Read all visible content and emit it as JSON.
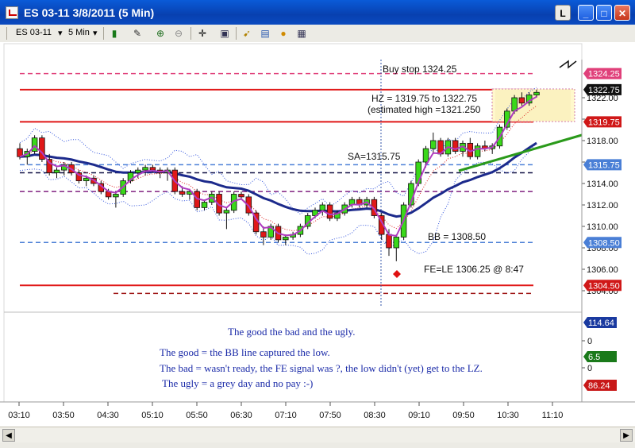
{
  "window": {
    "title": "ES 03-11  3/8/2011 (5 Min)",
    "buttons": [
      "L",
      "_",
      "□",
      "✕"
    ]
  },
  "toolbar": {
    "instrument": "ES 03-11",
    "interval": "5 Min"
  },
  "annotations": {
    "buy_stop": "Buy stop 1324.25",
    "hz": "HZ = 1319.75 to 1322.75",
    "est_high": "(estimated high =1321.250",
    "sa": "SA=1315.75",
    "bb": "BB = 1308.50",
    "fe": "FE=LE 1306.25 @ 8:47",
    "note_title": "The good the bad and the ugly.",
    "note_good": "The good = the BB line captured the low.",
    "note_bad": "The bad = wasn't ready, the FE signal was ?, the low didn't (yet) get to the LZ.",
    "note_ugly": "The ugly = a grey day and no pay :-)"
  },
  "chart_data": {
    "type": "candlestick",
    "interval": "5 Min",
    "x_labels": [
      "03:10",
      "03:50",
      "04:30",
      "05:10",
      "05:50",
      "06:30",
      "07:10",
      "07:50",
      "08:30",
      "09:10",
      "09:50",
      "10:30",
      "11:10"
    ],
    "y_ticks": [
      1304.0,
      1306.0,
      1308.0,
      1310.0,
      1312.0,
      1314.0,
      1316.0,
      1318.0,
      1320.0,
      1322.0
    ],
    "ylim": [
      1303.25,
      1325.25
    ],
    "price_tags": [
      {
        "label": "1324.25",
        "value": 1324.25,
        "color": "#e0407a"
      },
      {
        "label": "1322.75",
        "value": 1322.75,
        "color": "#111111"
      },
      {
        "label": "1319.75",
        "value": 1319.75,
        "color": "#d01818"
      },
      {
        "label": "1315.75",
        "value": 1315.75,
        "color": "#4a7fd6"
      },
      {
        "label": "1308.50",
        "value": 1308.5,
        "color": "#4a7fd6"
      },
      {
        "label": "1304.50",
        "value": 1304.5,
        "color": "#d01818"
      }
    ],
    "levels": [
      {
        "value": 1324.25,
        "color": "#e0407a",
        "style": "dashed"
      },
      {
        "value": 1322.75,
        "color": "#e01818",
        "style": "solid"
      },
      {
        "value": 1319.75,
        "color": "#e01818",
        "style": "solid"
      },
      {
        "value": 1315.75,
        "color": "#4a7fd6",
        "style": "dashed"
      },
      {
        "value": 1315.0,
        "color": "#111144",
        "style": "dashed"
      },
      {
        "value": 1313.25,
        "color": "#802080",
        "style": "dashed"
      },
      {
        "value": 1308.5,
        "color": "#4a7fd6",
        "style": "dashed"
      },
      {
        "value": 1304.5,
        "color": "#e01818",
        "style": "solid"
      },
      {
        "value": 1303.75,
        "color": "#a01818",
        "style": "dashed"
      }
    ],
    "candles": [
      {
        "o": 1317.25,
        "h": 1317.75,
        "l": 1316.25,
        "c": 1316.5
      },
      {
        "o": 1316.5,
        "h": 1317.25,
        "l": 1315.75,
        "c": 1317.0
      },
      {
        "o": 1317.0,
        "h": 1318.5,
        "l": 1316.75,
        "c": 1318.25
      },
      {
        "o": 1318.25,
        "h": 1318.5,
        "l": 1316.0,
        "c": 1316.25
      },
      {
        "o": 1316.25,
        "h": 1316.75,
        "l": 1314.75,
        "c": 1315.0
      },
      {
        "o": 1315.0,
        "h": 1315.5,
        "l": 1314.5,
        "c": 1315.25
      },
      {
        "o": 1315.25,
        "h": 1316.0,
        "l": 1314.75,
        "c": 1315.75
      },
      {
        "o": 1315.75,
        "h": 1316.0,
        "l": 1314.75,
        "c": 1315.0
      },
      {
        "o": 1315.0,
        "h": 1315.25,
        "l": 1314.0,
        "c": 1314.25
      },
      {
        "o": 1314.25,
        "h": 1314.75,
        "l": 1313.75,
        "c": 1314.5
      },
      {
        "o": 1314.5,
        "h": 1314.75,
        "l": 1313.75,
        "c": 1314.0
      },
      {
        "o": 1314.0,
        "h": 1314.25,
        "l": 1313.0,
        "c": 1313.25
      },
      {
        "o": 1313.25,
        "h": 1313.5,
        "l": 1312.5,
        "c": 1312.75
      },
      {
        "o": 1312.75,
        "h": 1313.25,
        "l": 1311.75,
        "c": 1313.0
      },
      {
        "o": 1313.0,
        "h": 1314.5,
        "l": 1312.75,
        "c": 1314.25
      },
      {
        "o": 1314.25,
        "h": 1315.25,
        "l": 1314.0,
        "c": 1315.0
      },
      {
        "o": 1315.0,
        "h": 1315.5,
        "l": 1314.5,
        "c": 1315.25
      },
      {
        "o": 1315.25,
        "h": 1315.75,
        "l": 1314.75,
        "c": 1315.5
      },
      {
        "o": 1315.5,
        "h": 1315.75,
        "l": 1315.0,
        "c": 1315.25
      },
      {
        "o": 1315.25,
        "h": 1315.5,
        "l": 1314.5,
        "c": 1315.0
      },
      {
        "o": 1315.0,
        "h": 1315.5,
        "l": 1314.25,
        "c": 1315.25
      },
      {
        "o": 1315.25,
        "h": 1315.5,
        "l": 1313.0,
        "c": 1313.25
      },
      {
        "o": 1313.25,
        "h": 1313.75,
        "l": 1312.75,
        "c": 1313.0
      },
      {
        "o": 1313.0,
        "h": 1313.5,
        "l": 1312.5,
        "c": 1313.25
      },
      {
        "o": 1313.25,
        "h": 1313.5,
        "l": 1311.5,
        "c": 1311.75
      },
      {
        "o": 1311.75,
        "h": 1312.5,
        "l": 1311.5,
        "c": 1312.25
      },
      {
        "o": 1312.25,
        "h": 1313.25,
        "l": 1312.0,
        "c": 1313.0
      },
      {
        "o": 1313.0,
        "h": 1313.25,
        "l": 1311.0,
        "c": 1311.25
      },
      {
        "o": 1311.25,
        "h": 1311.75,
        "l": 1309.75,
        "c": 1311.5
      },
      {
        "o": 1311.5,
        "h": 1313.25,
        "l": 1311.25,
        "c": 1313.0
      },
      {
        "o": 1313.0,
        "h": 1313.25,
        "l": 1312.5,
        "c": 1312.75
      },
      {
        "o": 1312.75,
        "h": 1313.0,
        "l": 1311.0,
        "c": 1311.25
      },
      {
        "o": 1311.25,
        "h": 1311.5,
        "l": 1309.25,
        "c": 1309.5
      },
      {
        "o": 1309.5,
        "h": 1310.0,
        "l": 1308.25,
        "c": 1309.0
      },
      {
        "o": 1309.0,
        "h": 1310.25,
        "l": 1308.75,
        "c": 1310.0
      },
      {
        "o": 1310.0,
        "h": 1310.25,
        "l": 1308.5,
        "c": 1308.75
      },
      {
        "o": 1308.75,
        "h": 1309.25,
        "l": 1308.25,
        "c": 1309.0
      },
      {
        "o": 1309.0,
        "h": 1309.5,
        "l": 1308.75,
        "c": 1309.25
      },
      {
        "o": 1309.25,
        "h": 1310.25,
        "l": 1309.0,
        "c": 1310.0
      },
      {
        "o": 1310.0,
        "h": 1311.25,
        "l": 1309.75,
        "c": 1311.0
      },
      {
        "o": 1311.0,
        "h": 1311.75,
        "l": 1310.75,
        "c": 1311.5
      },
      {
        "o": 1311.5,
        "h": 1312.25,
        "l": 1311.0,
        "c": 1312.0
      },
      {
        "o": 1312.0,
        "h": 1312.25,
        "l": 1310.5,
        "c": 1310.75
      },
      {
        "o": 1310.75,
        "h": 1311.5,
        "l": 1310.5,
        "c": 1311.25
      },
      {
        "o": 1311.25,
        "h": 1312.25,
        "l": 1311.0,
        "c": 1312.0
      },
      {
        "o": 1312.0,
        "h": 1312.75,
        "l": 1311.75,
        "c": 1312.5
      },
      {
        "o": 1312.5,
        "h": 1312.75,
        "l": 1311.75,
        "c": 1312.0
      },
      {
        "o": 1312.0,
        "h": 1312.75,
        "l": 1311.75,
        "c": 1312.5
      },
      {
        "o": 1312.5,
        "h": 1312.75,
        "l": 1310.75,
        "c": 1311.0
      },
      {
        "o": 1311.0,
        "h": 1311.25,
        "l": 1308.75,
        "c": 1309.25
      },
      {
        "o": 1309.25,
        "h": 1309.75,
        "l": 1307.25,
        "c": 1308.0
      },
      {
        "o": 1308.0,
        "h": 1309.25,
        "l": 1306.75,
        "c": 1309.0
      },
      {
        "o": 1309.0,
        "h": 1312.25,
        "l": 1308.75,
        "c": 1312.0
      },
      {
        "o": 1312.0,
        "h": 1314.25,
        "l": 1311.75,
        "c": 1314.0
      },
      {
        "o": 1314.0,
        "h": 1316.25,
        "l": 1313.75,
        "c": 1316.0
      },
      {
        "o": 1316.0,
        "h": 1317.5,
        "l": 1315.5,
        "c": 1317.25
      },
      {
        "o": 1317.25,
        "h": 1318.75,
        "l": 1316.75,
        "c": 1318.0
      },
      {
        "o": 1318.0,
        "h": 1318.25,
        "l": 1316.5,
        "c": 1316.75
      },
      {
        "o": 1316.75,
        "h": 1318.25,
        "l": 1316.5,
        "c": 1318.0
      },
      {
        "o": 1318.0,
        "h": 1318.25,
        "l": 1316.75,
        "c": 1317.0
      },
      {
        "o": 1317.0,
        "h": 1318.0,
        "l": 1316.5,
        "c": 1317.75
      },
      {
        "o": 1317.75,
        "h": 1318.25,
        "l": 1316.25,
        "c": 1316.5
      },
      {
        "o": 1316.5,
        "h": 1317.75,
        "l": 1316.25,
        "c": 1317.5
      },
      {
        "o": 1317.5,
        "h": 1318.0,
        "l": 1317.0,
        "c": 1317.25
      },
      {
        "o": 1317.25,
        "h": 1317.75,
        "l": 1316.75,
        "c": 1317.5
      },
      {
        "o": 1317.5,
        "h": 1319.5,
        "l": 1317.25,
        "c": 1319.25
      },
      {
        "o": 1319.25,
        "h": 1321.0,
        "l": 1319.0,
        "c": 1320.75
      },
      {
        "o": 1320.75,
        "h": 1322.25,
        "l": 1320.5,
        "c": 1322.0
      },
      {
        "o": 1322.0,
        "h": 1322.5,
        "l": 1321.25,
        "c": 1321.5
      },
      {
        "o": 1321.5,
        "h": 1322.5,
        "l": 1321.25,
        "c": 1322.25
      },
      {
        "o": 1322.25,
        "h": 1322.75,
        "l": 1322.0,
        "c": 1322.5
      }
    ],
    "indicator_tags": [
      {
        "label": "114.64",
        "color": "#1a3aa0"
      },
      {
        "label": "6.5",
        "color": "#1a7a1a"
      },
      {
        "label": "86.24",
        "color": "#c81818"
      }
    ],
    "indicator_ticks": [
      "0",
      "0"
    ]
  }
}
